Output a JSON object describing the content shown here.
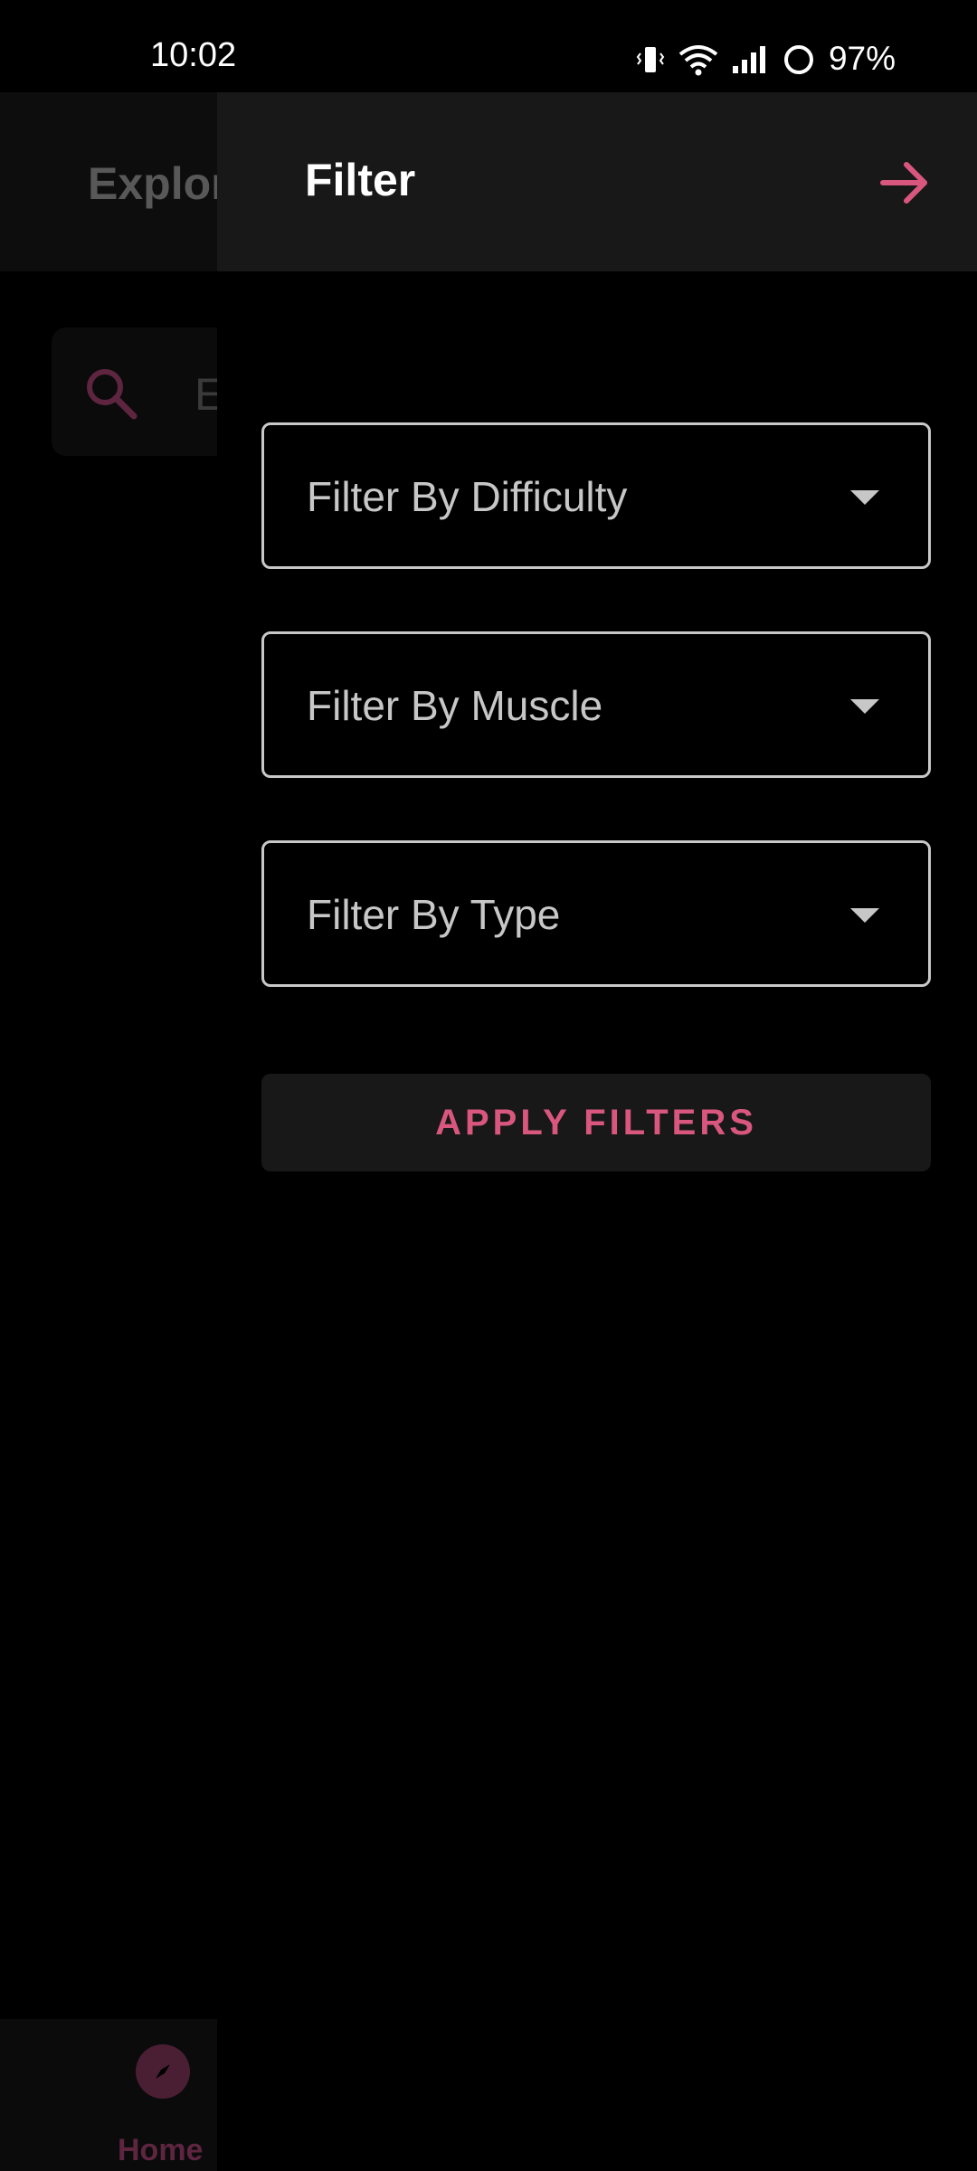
{
  "status_bar": {
    "time": "10:02",
    "battery": "97%",
    "icons": [
      "vibrate-icon",
      "wifi-icon",
      "signal-icon",
      "battery-ring-icon"
    ]
  },
  "background": {
    "title": "Explor",
    "search_placeholder": "E",
    "bottom_nav": {
      "home_label": "Home",
      "home_icon": "compass-icon"
    }
  },
  "drawer": {
    "title": "Filter",
    "close_icon": "arrow-right-icon",
    "filters": [
      {
        "label": "Filter By Difficulty"
      },
      {
        "label": "Filter By Muscle"
      },
      {
        "label": "Filter By Type"
      }
    ],
    "apply_label": "APPLY FILTERS"
  },
  "colors": {
    "accent": "#d9577f",
    "surface": "#181818",
    "background": "#000000"
  }
}
